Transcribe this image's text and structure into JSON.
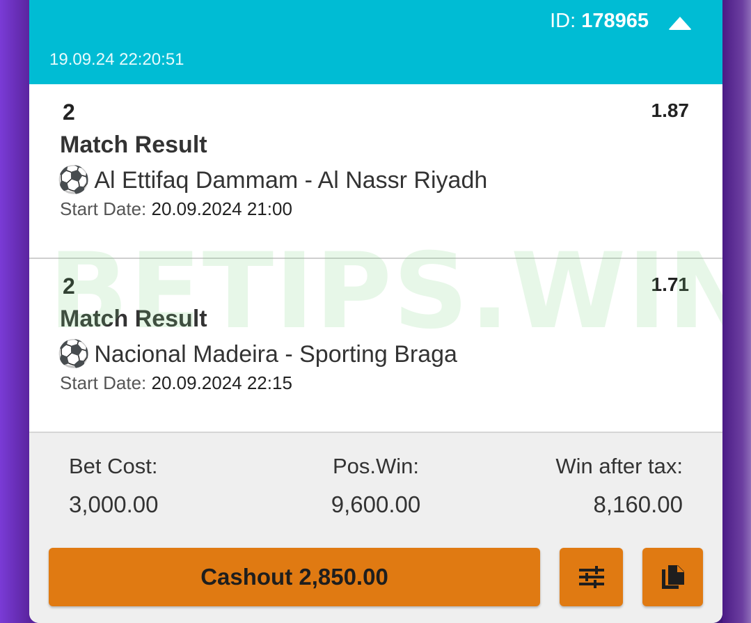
{
  "header": {
    "id_label": "ID: ",
    "id_value": "178965",
    "timestamp": "19.09.24 22:20:51"
  },
  "selections": [
    {
      "pick": "2",
      "odds": "1.87",
      "market": "Match Result",
      "event": "Al Ettifaq Dammam - Al Nassr Riyadh",
      "start_label": "Start Date: ",
      "start_value": "20.09.2024 21:00"
    },
    {
      "pick": "2",
      "odds": "1.71",
      "market": "Match Result",
      "event": "Nacional Madeira - Sporting Braga",
      "start_label": "Start Date: ",
      "start_value": "20.09.2024 22:15"
    }
  ],
  "watermark": "BETIPS.WIN",
  "summary": {
    "bet_cost_label": "Bet Cost:",
    "bet_cost_value": "3,000.00",
    "pos_win_label": "Pos.Win:",
    "pos_win_value": "9,600.00",
    "win_after_tax_label": "Win after tax:",
    "win_after_tax_value": "8,160.00"
  },
  "actions": {
    "cashout_label": "Cashout 2,850.00",
    "settings_icon": "sliders-icon",
    "copy_icon": "copy-icon"
  },
  "colors": {
    "header_bg": "#00bcd4",
    "button_bg": "#e07a12",
    "footer_bg": "#efefef"
  }
}
